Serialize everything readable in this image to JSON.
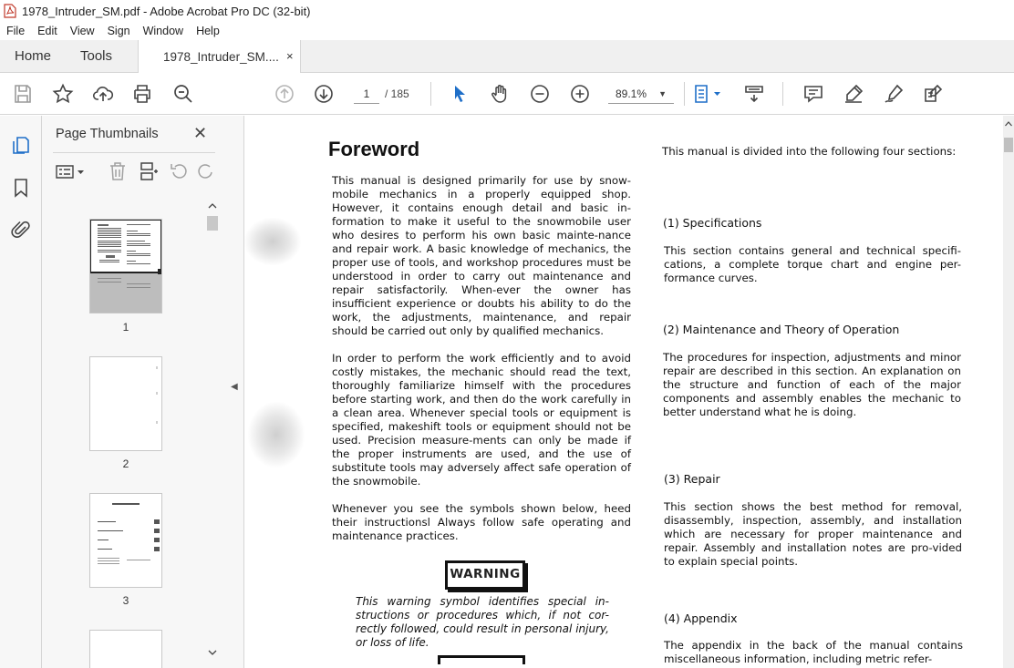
{
  "window": {
    "title": "1978_Intruder_SM.pdf - Adobe Acrobat Pro DC (32-bit)"
  },
  "menu": [
    "File",
    "Edit",
    "View",
    "Sign",
    "Window",
    "Help"
  ],
  "tabs": {
    "home": "Home",
    "tools": "Tools",
    "document": "1978_Intruder_SM....",
    "close": "×"
  },
  "toolbar": {
    "page_current": "1",
    "page_total": "/ 185",
    "zoom": "89.1%"
  },
  "panel": {
    "title": "Page Thumbnails",
    "close": "✕",
    "thumbnails": [
      {
        "label": "1"
      },
      {
        "label": "2"
      },
      {
        "label": "3"
      }
    ]
  },
  "document": {
    "title": "Foreword",
    "left_col": {
      "p1": "This manual is designed primarily for use by snow-mobile mechanics in a properly equipped shop. However, it contains enough detail and basic in-formation to make it useful to the snowmobile user who desires to perform his own basic mainte-nance and repair work. A basic knowledge of mechanics, the proper use of tools, and workshop procedures must be understood in order to carry out maintenance and repair satisfactorily. When-ever the owner has insufficient experience or doubts his ability to do the work, the adjustments, maintenance, and repair should be carried out only by qualified mechanics.",
      "p2": "In order to perform the work efficiently and to avoid costly mistakes, the mechanic should read the text, thoroughly familiarize himself with the procedures before starting work, and then do the work carefully in a clean area. Whenever special tools or equipment is specified, makeshift tools or equipment should not be used. Precision measure-ments can only be made if the proper instruments are used, and the use of substitute tools may adversely affect safe operation of the snowmobile.",
      "p3": "Whenever you see the symbols shown below, heed their instructionsl Always follow safe operating and maintenance practices.",
      "warning_label": "WARNING",
      "warning_text": "This warning symbol identifies special in-structions or procedures which, if not cor-rectly followed, could result in personal injury, or loss of life."
    },
    "right_col": {
      "intro": "This manual is divided into the following four sections:",
      "s1_title": "(1) Specifications",
      "s1_text": "This section contains general and technical specifi-cations, a complete torque chart and engine per-formance curves.",
      "s2_title": "(2) Maintenance and Theory of Operation",
      "s2_text": "The procedures for inspection, adjustments and minor repair are described in this section. An explanation on the structure and function of each of the major components and assembly enables the mechanic to better understand what he is doing.",
      "s3_title": "(3) Repair",
      "s3_text": "This section shows the best method for removal, disassembly, inspection, assembly, and installation which are necessary for proper maintenance and repair. Assembly and installation notes are pro-vided to explain special points.",
      "s4_title": "(4) Appendix",
      "s4_text": "The appendix in the back of the manual contains miscellaneous information, including metric refer-"
    }
  }
}
